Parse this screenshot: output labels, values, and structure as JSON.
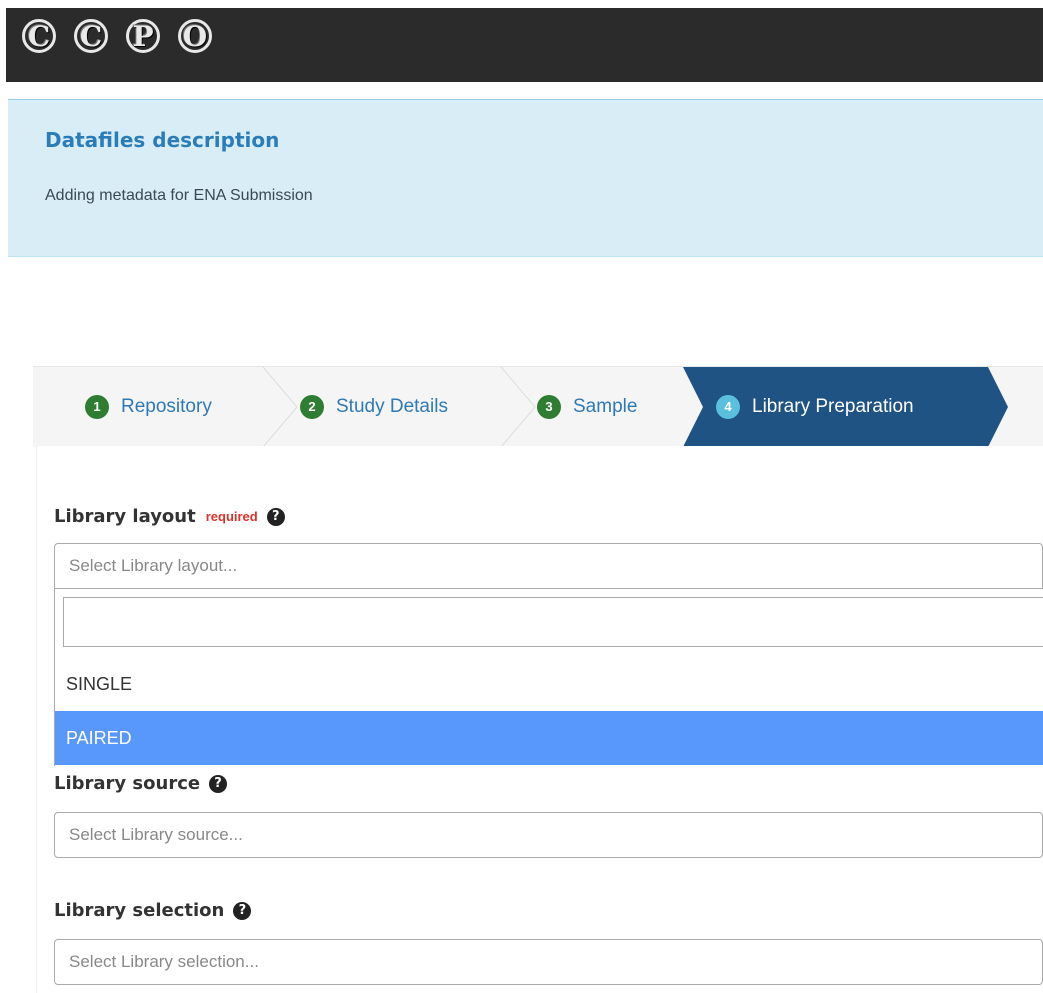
{
  "header": {
    "logo_letters": [
      "C",
      "C",
      "P",
      "O"
    ]
  },
  "info": {
    "title": "Datafiles description",
    "subtitle": "Adding metadata for ENA Submission"
  },
  "wizard": {
    "steps": [
      {
        "number": "1",
        "label": "Repository"
      },
      {
        "number": "2",
        "label": "Study Details"
      },
      {
        "number": "3",
        "label": "Sample"
      },
      {
        "number": "4",
        "label": "Library Preparation"
      }
    ],
    "active_step": 4
  },
  "form": {
    "library_layout": {
      "label": "Library layout",
      "required_text": "required",
      "placeholder": "Select Library layout...",
      "search_value": "",
      "options": [
        "SINGLE",
        "PAIRED"
      ],
      "highlighted_option": "PAIRED"
    },
    "library_source": {
      "label": "Library source",
      "placeholder": "Select Library source..."
    },
    "library_selection": {
      "label": "Library selection",
      "placeholder": "Select Library selection..."
    }
  },
  "icons": {
    "help": "question-circle-icon"
  },
  "colors": {
    "topbar": "#2b2b2b",
    "info_bg": "#d9edf7",
    "info_title": "#2a7db8",
    "step_text": "#2f79b6",
    "step_num_done": "#2e7d32",
    "step_active_bg": "#1f5383",
    "step_active_num": "#5bc0de",
    "required": "#d9342b",
    "highlight": "#5897fb"
  }
}
